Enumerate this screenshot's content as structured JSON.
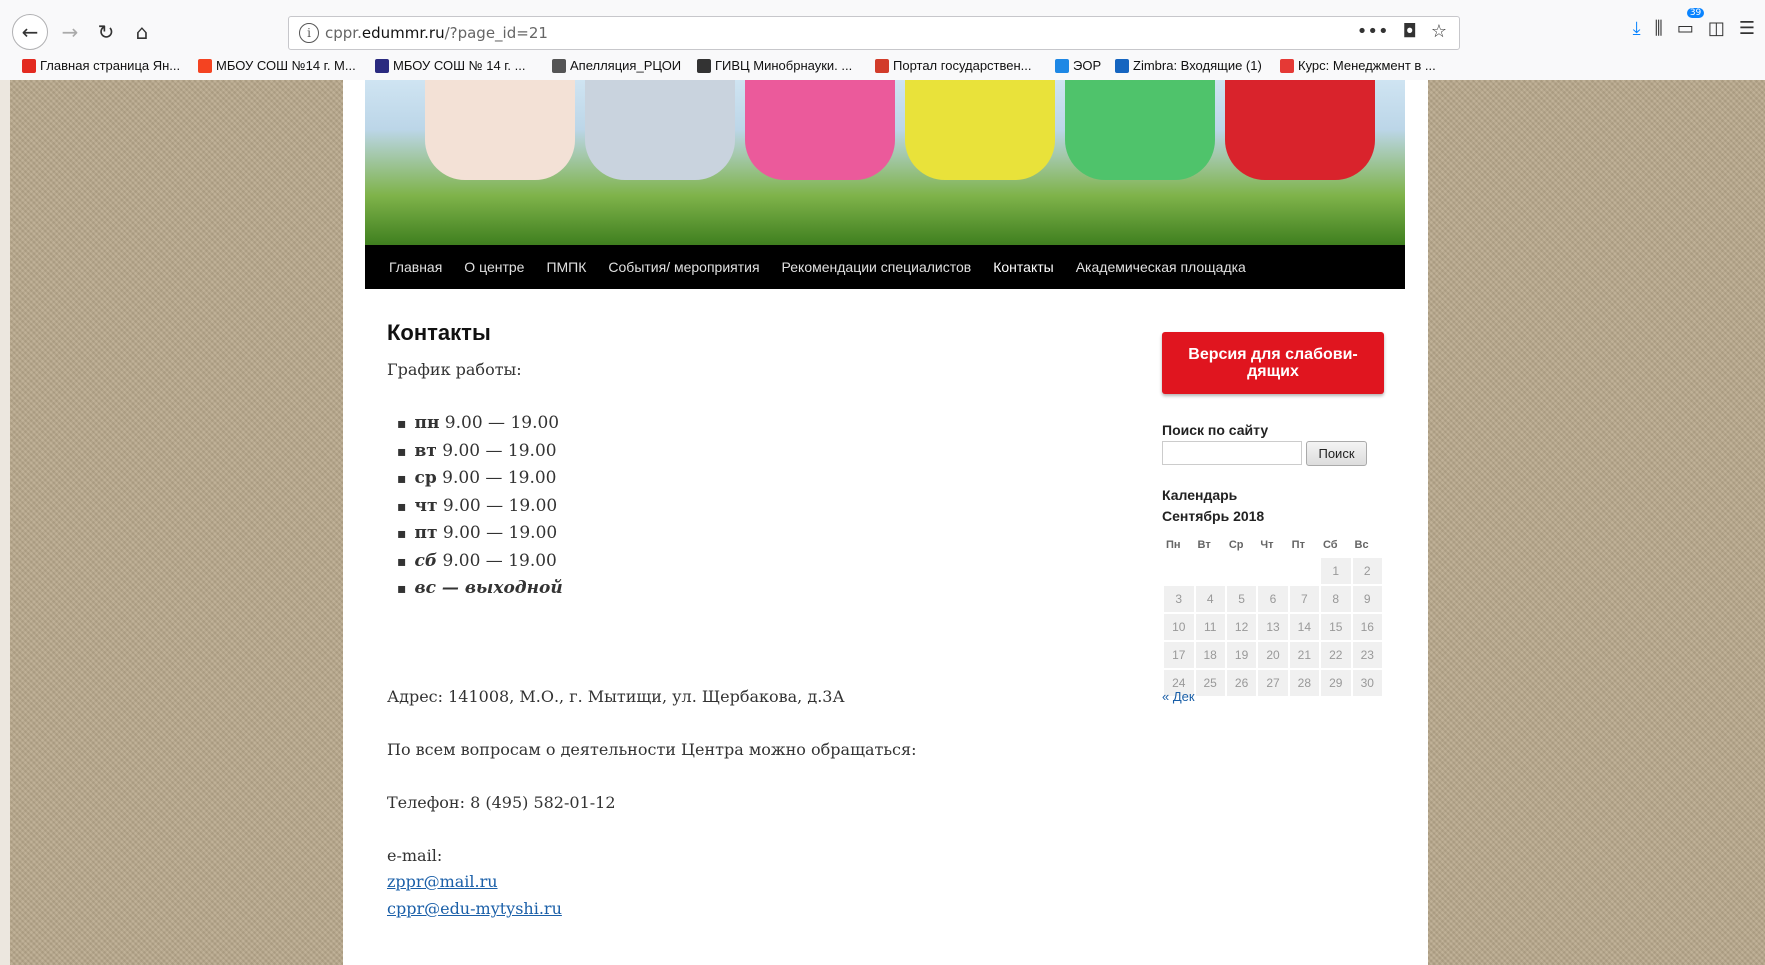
{
  "browser": {
    "url_prefix": "cppr.",
    "url_domain": "edummr.ru",
    "url_path": "/?page_id=21",
    "tabs_badge": "39",
    "bookmarks": [
      {
        "label": "Главная страница Ян...",
        "icon": "yandex-icon",
        "color": "#e32a20"
      },
      {
        "label": "МБОУ СОШ №14 г. М...",
        "icon": "joomla-icon",
        "color": "#f44321"
      },
      {
        "label": "МБОУ СОШ № 14 г. ...",
        "icon": "school-icon",
        "color": "#2b2b80"
      },
      {
        "label": "Апелляция_РЦОИ",
        "icon": "globe-icon",
        "color": "#555555"
      },
      {
        "label": "ГИВЦ Минобрнауки. ...",
        "icon": "eagle-icon",
        "color": "#333333"
      },
      {
        "label": "Портал государствен...",
        "icon": "portal-icon",
        "color": "#d23c2a"
      },
      {
        "label": "ЭОР",
        "icon": "eor-icon",
        "color": "#1e88e5"
      },
      {
        "label": "Zimbra: Входящие (1)",
        "icon": "zimbra-icon",
        "color": "#1565c0"
      },
      {
        "label": "Курс: Менеджмент в ...",
        "icon": "course-icon",
        "color": "#e53935"
      }
    ]
  },
  "menu": {
    "items": [
      {
        "label": "Главная",
        "active": false
      },
      {
        "label": "О центре",
        "active": false
      },
      {
        "label": "ПМПК",
        "active": false
      },
      {
        "label": "События/ мероприятия",
        "active": false
      },
      {
        "label": "Рекомендации специалистов",
        "active": false
      },
      {
        "label": "Контакты",
        "active": true
      },
      {
        "label": "Академическая площадка",
        "active": false
      }
    ]
  },
  "content": {
    "title": "Контакты",
    "schedule_heading": "График работы:",
    "schedule": [
      {
        "day": "пн",
        "time": " 9.00 — 19.00"
      },
      {
        "day": "вт",
        "time": " 9.00 — 19.00"
      },
      {
        "day": "ср",
        "time": " 9.00 — 19.00"
      },
      {
        "day": "чт",
        "time": " 9.00 — 19.00"
      },
      {
        "day": "пт",
        "time": " 9.00 — 19.00"
      },
      {
        "day": "сб",
        "time": " 9.00 — 19.00"
      },
      {
        "day": "вс",
        "time": " — выходной"
      }
    ],
    "address": "Адрес: 141008, М.О., г. Мытищи, ул. Щербакова, д.3А",
    "questions": "По всем вопросам о деятельности Центра можно обращаться:",
    "phone": "Телефон: 8 (495) 582-01-12",
    "email_label": "e-mail:",
    "email1": "zppr@mail.ru",
    "email2": "cppr@edu-mytyshi.ru"
  },
  "sidebar": {
    "vision_button_line1": "Версия для слабови-",
    "vision_button_line2": "дящих",
    "search_label": "Поиск по сайту",
    "search_button": "Поиск",
    "calendar_label": "Календарь",
    "calendar_month": "Сентябрь 2018",
    "weekdays": [
      "Пн",
      "Вт",
      "Ср",
      "Чт",
      "Пт",
      "Сб",
      "Вс"
    ],
    "weeks": [
      [
        "",
        "",
        "",
        "",
        "",
        "1",
        "2"
      ],
      [
        "3",
        "4",
        "5",
        "6",
        "7",
        "8",
        "9"
      ],
      [
        "10",
        "11",
        "12",
        "13",
        "14",
        "15",
        "16"
      ],
      [
        "17",
        "18",
        "19",
        "20",
        "21",
        "22",
        "23"
      ],
      [
        "24",
        "25",
        "26",
        "27",
        "28",
        "29",
        "30"
      ]
    ],
    "prev_link": "« Дек"
  }
}
